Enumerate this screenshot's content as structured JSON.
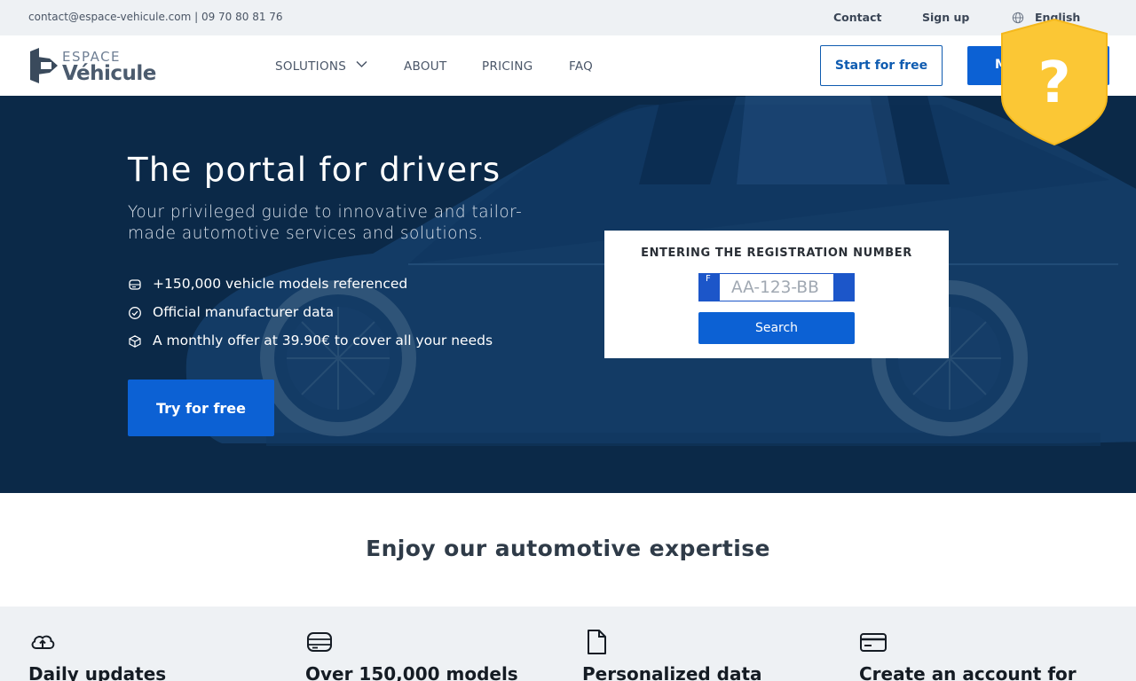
{
  "topbar": {
    "contact_line": "contact@espace-vehicule.com | 09 70 80 81 76",
    "contact_link": "Contact",
    "signup_link": "Sign up",
    "language": "English"
  },
  "nav": {
    "logo_top": "ESPACE",
    "logo_bottom": "Véhicule",
    "menu": {
      "solutions": "SOLUTIONS",
      "about": "ABOUT",
      "pricing": "PRICING",
      "faq": "FAQ"
    },
    "start_button": "Start for free",
    "filled_button_partial": "M"
  },
  "hero": {
    "title": "The portal for drivers",
    "subtitle": "Your privileged guide to innovative and tailor-made automotive services and solutions.",
    "features": [
      {
        "icon": "database-icon",
        "text": "+150,000 vehicle models referenced"
      },
      {
        "icon": "check-circle-icon",
        "text": "Official manufacturer data"
      },
      {
        "icon": "cube-icon",
        "text": "A monthly offer at 39.90€ to cover all your needs"
      }
    ],
    "cta": "Try for free"
  },
  "registration": {
    "title": "ENTERING THE REGISTRATION NUMBER",
    "country_code": "F",
    "placeholder": "AA-123-BB",
    "search_button": "Search"
  },
  "expertise": {
    "title": "Enjoy our automotive expertise",
    "cards": [
      {
        "icon": "cloud-upload-icon",
        "title": "Daily updates"
      },
      {
        "icon": "database-icon",
        "title": "Over 150,000 models"
      },
      {
        "icon": "file-icon",
        "title": "Personalized data"
      },
      {
        "icon": "credit-card-icon",
        "title": "Create an account for"
      }
    ]
  },
  "colors": {
    "hero_background": "#0b2948",
    "primary_blue": "#0c61d4",
    "help_badge": "#fbc735"
  }
}
